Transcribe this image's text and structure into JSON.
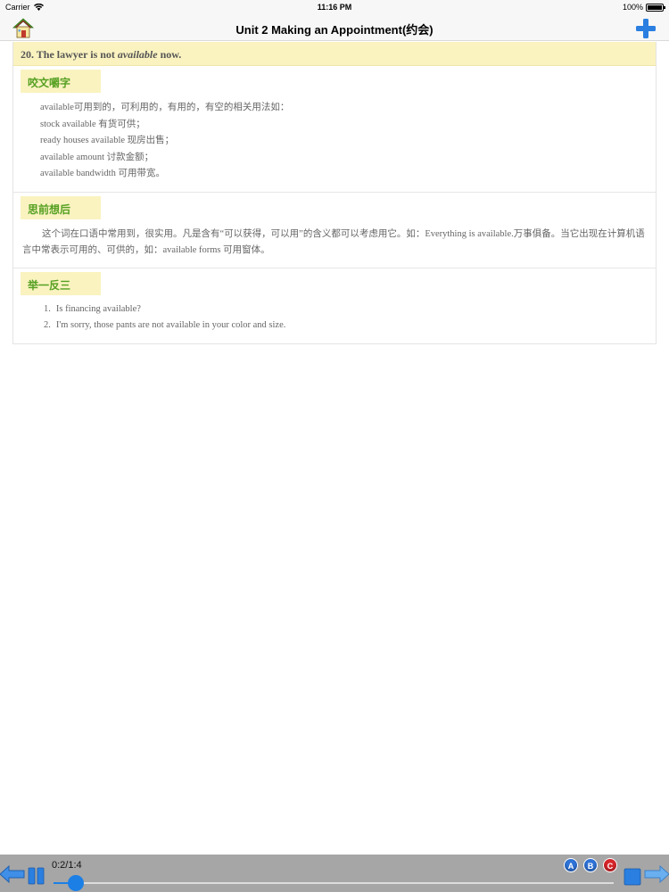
{
  "status": {
    "carrier": "Carrier",
    "time": "11:16 PM",
    "battery": "100%"
  },
  "nav": {
    "title": "Unit 2 Making an Appointment(约会)"
  },
  "sentence": {
    "number": "20.",
    "before": "The lawyer is not",
    "keyword": "available",
    "after": "now."
  },
  "sections": {
    "word_study": {
      "title": "咬文嚼字",
      "lines": [
        "available可用到的，可利用的，有用的，有空的相关用法如：",
        "stock available 有货可供；",
        "ready houses available 现房出售；",
        "available amount 讨款金额；",
        "available bandwidth 可用带宽。"
      ]
    },
    "reflection": {
      "title": "思前想后",
      "text": "这个词在口语中常用到，很实用。凡是含有“可以获得，可以用”的含义都可以考虑用它。如：Everything is available.万事俱备。当它出现在计算机语言中常表示可用的、可供的，如：available forms 可用窗体。"
    },
    "examples": {
      "title": "举一反三",
      "items": [
        {
          "num": "1.",
          "text": "Is financing available?"
        },
        {
          "num": "2.",
          "text": "I'm sorry, those pants are not available in your color and size."
        }
      ]
    }
  },
  "player": {
    "progress_label": "0:2/1:4",
    "progress": 0.04,
    "buttons": [
      "A",
      "B",
      "C"
    ],
    "colors": {
      "accent": "#1b7fe6",
      "a": "#2f73d8",
      "b": "#2f73d8",
      "c": "#d8262a"
    }
  },
  "icons": [
    "wifi-icon",
    "home-icon",
    "plus-icon",
    "back-arrow-icon",
    "pause-icon",
    "stop-icon",
    "forward-arrow-icon"
  ]
}
